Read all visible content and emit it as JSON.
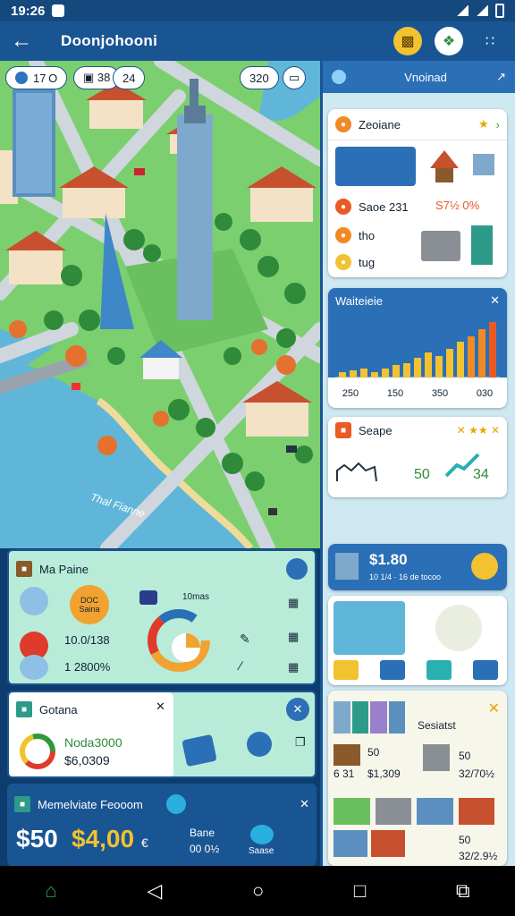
{
  "status": {
    "time": "19:26"
  },
  "appbar": {
    "title": "Doonjohooni",
    "back_icon": "arrow-left-icon"
  },
  "map": {
    "hud_left": [
      "17 O",
      "▣ 38",
      "24"
    ],
    "hud_right": "320",
    "water_label": "Thal Fianne",
    "colors": {
      "grass": "#7ccf6e",
      "water": "#5fb6d8",
      "road": "#cfd6dd"
    }
  },
  "rpanel": {
    "header": "Vnoinad",
    "overview": {
      "title": "Zeoiane",
      "items": [
        {
          "label": "Saoe 231",
          "value": "S7½ 0%"
        },
        {
          "label": "tho"
        },
        {
          "label": "tug"
        }
      ]
    },
    "chart": {
      "title": "Waiteieie",
      "ticks": [
        "250",
        "150",
        "350",
        "030"
      ]
    },
    "scape": {
      "title": "Seape",
      "value1": "50",
      "value2": "34"
    },
    "money": {
      "amount": "$1.80",
      "caption": "10 1/4 · 16 de tocoo"
    },
    "stats": {
      "title": "Sesiatst",
      "rows": [
        {
          "a": "50",
          "b": "6 31",
          "c": "$1,309"
        },
        {
          "a": "50",
          "b": "32/70½"
        },
        {
          "a": "50",
          "b": "32/2.9½"
        }
      ]
    }
  },
  "bottom": {
    "main": {
      "title": "Ma Paine",
      "badge1": "DOC Saina",
      "metric1": "10.0/138",
      "metric2": "1 2800%",
      "side_label": "10mas"
    },
    "gotana": {
      "title": "Gotana",
      "line1": "Noda3000",
      "line2": "$6,0309"
    },
    "finance": {
      "title": "Memelviate Feooom",
      "big1": "$50",
      "big2": "$4,00",
      "small": "€",
      "label1": "Bane",
      "label2": "00 0½",
      "label3": "Saase"
    }
  }
}
